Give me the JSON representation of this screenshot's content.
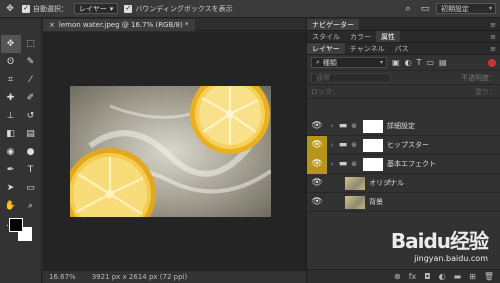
{
  "options_bar": {
    "move_icon": "move-tool-icon",
    "auto_select_label": "自動選択：",
    "auto_select_checked": true,
    "auto_select_target": "レイヤー",
    "bounding_box_label": "バウンディングボックスを表示",
    "bounding_box_checked": true,
    "preset": "初期設定"
  },
  "document": {
    "tab_title": "lemon water.jpeg @ 16.7% (RGB/8) *",
    "close_glyph": "×",
    "zoom": "16.67%",
    "info": "3921 px x 2614 px (72 ppi)"
  },
  "panels": {
    "top_tabs": [
      "ナビゲーター"
    ],
    "mid_tabs": [
      "スタイル",
      "カラー",
      "属性"
    ],
    "mid_active": "属性",
    "layer_tabs": [
      "レイヤー",
      "チャンネル",
      "パス"
    ],
    "layer_active": "レイヤー",
    "kind_label": "種類",
    "blend_mode": "通常",
    "opacity_label": "不透明度：",
    "lock_label": "ロック：",
    "fill_label": "塗り："
  },
  "layers": [
    {
      "name": "詳細設定",
      "type": "group",
      "eye_highlight": false
    },
    {
      "name": "ヒップスター",
      "type": "group",
      "eye_highlight": true
    },
    {
      "name": "基本エフェクト",
      "type": "group",
      "eye_highlight": true
    },
    {
      "name": "オリジナル",
      "type": "image",
      "eye_highlight": false
    },
    {
      "name": "背景",
      "type": "image",
      "eye_highlight": false
    }
  ],
  "watermark": {
    "logo": "Baidu经验",
    "url": "jingyan.baidu.com"
  },
  "colors": {
    "highlight": "#b8951a",
    "toggle": "#cc3333"
  }
}
